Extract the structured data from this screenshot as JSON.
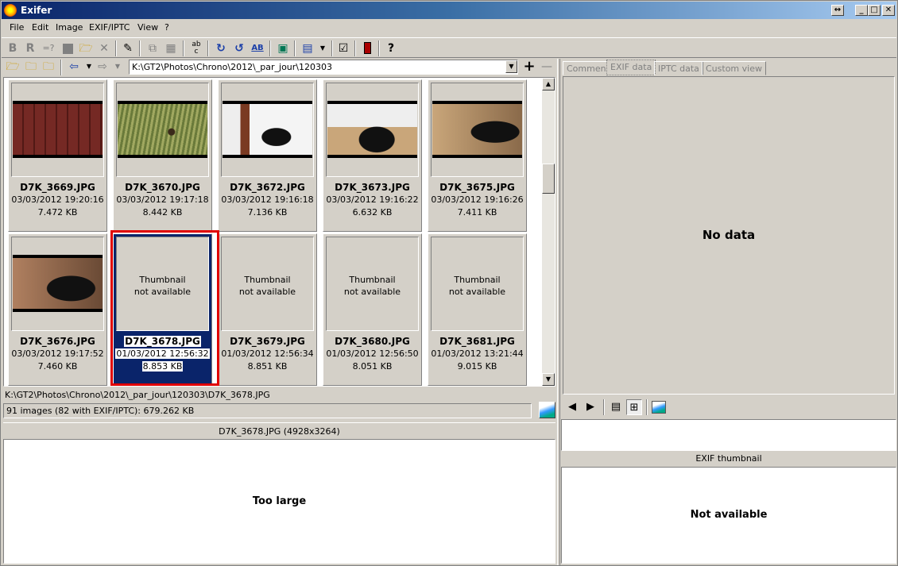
{
  "window": {
    "title": "Exifer"
  },
  "menu": [
    "File",
    "Edit",
    "Image",
    "EXIF/IPTC",
    "View",
    "?"
  ],
  "toolbar": {
    "icons": [
      "bold-b-icon",
      "regular-r-icon",
      "equals-question-icon",
      "stop-square-icon",
      "open-folder-icon",
      "delete-x-icon",
      "edit-icon",
      "copy-icon",
      "table-icon",
      "rename-ab-icon",
      "rotate-left-icon",
      "rotate-right-icon",
      "text-ab-icon",
      "slideshow-icon",
      "view-mode-icon",
      "checklist-icon",
      "phone-icon",
      "help-icon"
    ]
  },
  "nav": {
    "path": "K:\\GT2\\Photos\\Chrono\\2012\\_par_jour\\120303",
    "add_label": "+",
    "remove_label": "—"
  },
  "thumbnails": [
    {
      "name": "D7K_3669.JPG",
      "date": "03/03/2012 19:20:16",
      "size": "7.472 KB",
      "image": "roof-tiles",
      "thumb": true
    },
    {
      "name": "D7K_3670.JPG",
      "date": "03/03/2012 19:17:18",
      "size": "8.442 KB",
      "image": "bird-grass",
      "thumb": true
    },
    {
      "name": "D7K_3672.JPG",
      "date": "03/03/2012 19:16:18",
      "size": "7.136 KB",
      "image": "cat-doorway",
      "thumb": true
    },
    {
      "name": "D7K_3673.JPG",
      "date": "03/03/2012 19:16:22",
      "size": "6.632 KB",
      "image": "cat-lying",
      "thumb": true
    },
    {
      "name": "D7K_3675.JPG",
      "date": "03/03/2012 19:16:26",
      "size": "7.411 KB",
      "image": "cat-closeup",
      "thumb": true
    },
    {
      "name": "D7K_3676.JPG",
      "date": "03/03/2012 19:17:52",
      "size": "7.460 KB",
      "image": "cat-face",
      "thumb": true
    },
    {
      "name": "D7K_3678.JPG",
      "date": "01/03/2012 12:56:32",
      "size": "8.853 KB",
      "na_line1": "Thumbnail",
      "na_line2": "not available",
      "thumb": false,
      "selected": true
    },
    {
      "name": "D7K_3679.JPG",
      "date": "01/03/2012 12:56:34",
      "size": "8.851 KB",
      "na_line1": "Thumbnail",
      "na_line2": "not available",
      "thumb": false
    },
    {
      "name": "D7K_3680.JPG",
      "date": "01/03/2012 12:56:50",
      "size": "8.051 KB",
      "na_line1": "Thumbnail",
      "na_line2": "not available",
      "thumb": false
    },
    {
      "name": "D7K_3681.JPG",
      "date": "01/03/2012 13:21:44",
      "size": "9.015 KB",
      "na_line1": "Thumbnail",
      "na_line2": "not available",
      "thumb": false
    }
  ],
  "status": {
    "file_path": "K:\\GT2\\Photos\\Chrono\\2012\\_par_jour\\120303\\D7K_3678.JPG",
    "summary": "91 images (82 with EXIF/IPTC): 679.262 KB"
  },
  "preview": {
    "header": "D7K_3678.JPG (4928x3264)",
    "message": "Too large"
  },
  "tabs": [
    "Comment",
    "EXIF data",
    "IPTC data",
    "Custom view"
  ],
  "active_tab": "EXIF data",
  "exif_panel": {
    "message": "No data"
  },
  "exif_thumbnail": {
    "header": "EXIF thumbnail",
    "message": "Not available"
  },
  "colors": {
    "selection": "#0a246a",
    "highlight_border": "#e00000",
    "window_bg": "#d4d0c8"
  }
}
